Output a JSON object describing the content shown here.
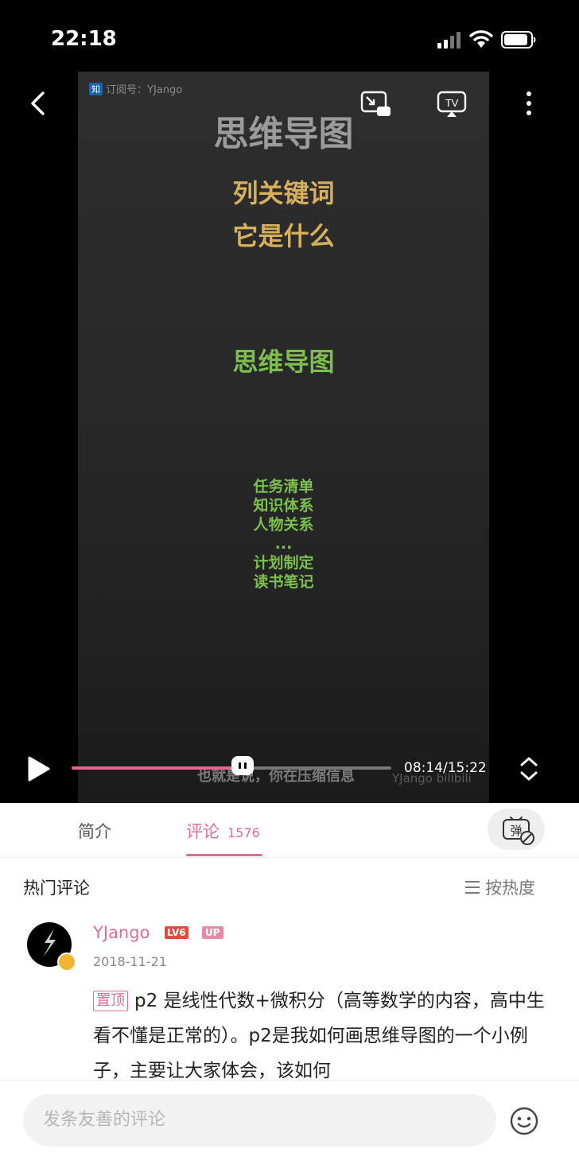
{
  "status_bar": {
    "time": "22:18"
  },
  "video": {
    "watermark": {
      "badge": "知",
      "text": "订阅号：YJango"
    },
    "slide": {
      "title": "思维导图",
      "lines_gold": [
        "列关键词",
        "它是什么"
      ],
      "line_green": "思维导图",
      "list_green": [
        "任务清单",
        "知识体系",
        "人物关系",
        "...",
        "计划制定",
        "读书笔记"
      ]
    },
    "subtitle": "也就是说，你在压缩信息",
    "brand": "YJango bilibili",
    "controls": {
      "current_time": "08:14",
      "duration": "15:22",
      "time_display": "08:14/15:22",
      "progress": 0.535
    },
    "icons": [
      "back-icon",
      "pip-icon",
      "tv-cast-icon",
      "more-icon",
      "play-icon",
      "fullscreen-icon"
    ]
  },
  "tabs": [
    {
      "label": "简介",
      "active": false
    },
    {
      "label": "评论",
      "count": "1576",
      "active": true
    }
  ],
  "danmaku_toggle": {
    "label": "弹"
  },
  "hot_section": {
    "title": "热门评论",
    "sort_label": "按热度"
  },
  "comment": {
    "username": "YJango",
    "level": "LV6",
    "up_badge": "UP",
    "date": "2018-11-21",
    "pin_label": "置顶",
    "text": "p2 是线性代数+微积分（高等数学的内容，高中生看不懂是正常的）。p2是我如何画思维导图的一个小例子，主要让大家体会，该如何"
  },
  "comment_input": {
    "placeholder": "发条友善的评论"
  },
  "colors": {
    "accent": "#e26b8f",
    "slide_gold": "#d6b05b",
    "slide_green": "#7bbf4d"
  }
}
